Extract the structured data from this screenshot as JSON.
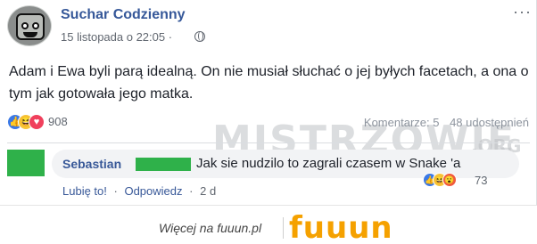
{
  "post": {
    "page_name": "Suchar Codzienny",
    "timestamp": "15 listopada o 22:05 ·",
    "text": "Adam i Ewa byli parą idealną. On nie musiał słuchać o jej byłych facetach, a ona o tym jak gotowała jego matka.",
    "reaction_count": "908",
    "comments_label": "Komentarze: 5",
    "shares_label": "48 udostępnień",
    "more_icon": "ellipsis-icon",
    "privacy_icon": "globe-icon"
  },
  "comment": {
    "author": "Sebastian",
    "text": "Jak sie nudzilo to zagrali czasem w Snake 'a",
    "reaction_count": "73",
    "like_label": "Lubię to!",
    "reply_label": "Odpowiedz",
    "age": "2 d"
  },
  "watermark": {
    "text": "MISTRZOWIE",
    "suffix": ".ORG"
  },
  "footer": {
    "text": "Więcej na fuuun.pl",
    "brand": "fuuun"
  },
  "colors": {
    "link": "#365899",
    "like": "#3b79e6",
    "haha": "#f7c43b",
    "love": "#f0405c",
    "brand": "#f5a100",
    "redaction": "#2fb14a"
  }
}
